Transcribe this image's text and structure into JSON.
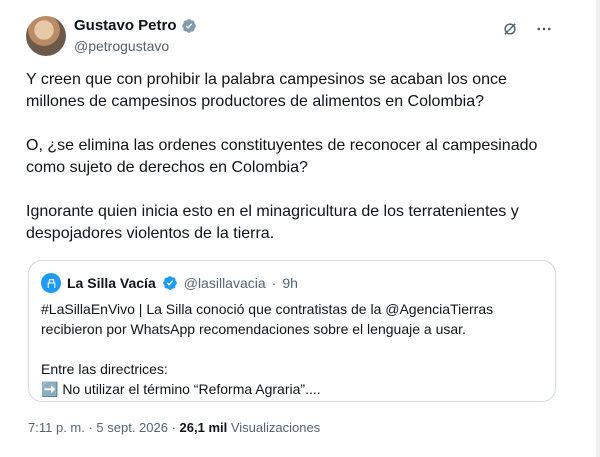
{
  "tweet": {
    "author_name": "Gustavo Petro",
    "author_handle": "@petrogustavo",
    "text": "Y creen que con prohibir la palabra campesinos se acaban los once millones de campesinos productores de alimentos en Colombia?\n\nO, ¿se elimina las ordenes constituyentes de reconocer al campesinado como sujeto de derechos en Colombia?\n\nIgnorante quien inicia esto en  el minagricultura de los terratenientes y despojadores violentos de la tierra.",
    "time": "7:11 p. m.",
    "separator": " · ",
    "date": "5 sept. 2026",
    "views_count": "26,1 mil",
    "views_label": " Visualizaciones"
  },
  "quote": {
    "name": "La Silla Vacía",
    "handle": "@lasillavacia",
    "dot": "·",
    "age": "9h",
    "text": "#LaSillaEnVivo | La Silla conoció que contratistas de la @AgenciaTierras recibieron por WhatsApp recomendaciones sobre el lenguaje a usar.\n\nEntre las directrices:\n➡️ No utilizar el término “Reforma Agraria”...."
  },
  "icons": {
    "verified": "verified-badge-icon",
    "grok": "grok-icon",
    "more": "more-icon"
  },
  "colors": {
    "accent": "#1d9bf0",
    "secondary_text": "#536471",
    "border": "#cfd9de"
  }
}
